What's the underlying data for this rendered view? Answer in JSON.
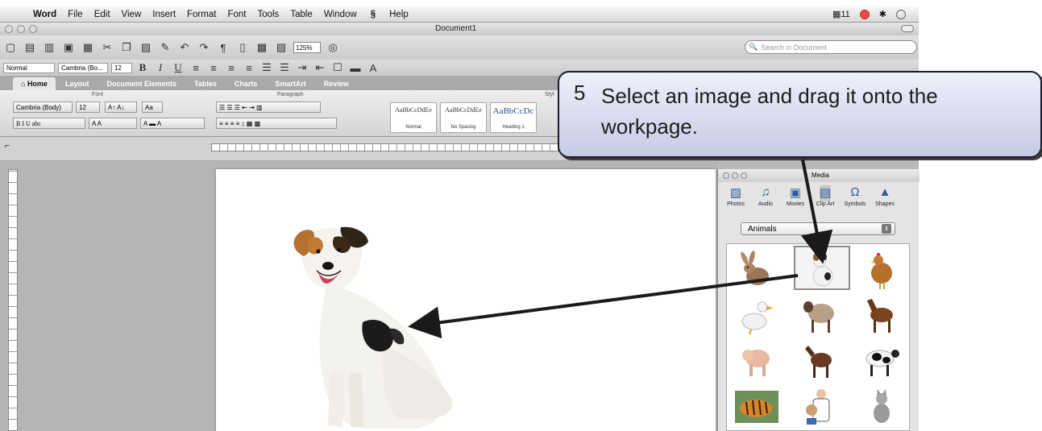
{
  "menubar": {
    "apple": "",
    "items": [
      "Word",
      "File",
      "Edit",
      "View",
      "Insert",
      "Format",
      "Font",
      "Tools",
      "Table",
      "Window",
      "Help"
    ],
    "script_icon": "script-menu-icon",
    "status": "11"
  },
  "window": {
    "title": "Document1",
    "zoom": "125%",
    "search_placeholder": "Search in Document"
  },
  "format_toolbar": {
    "style": "Normal",
    "font": "Cambria (Bo...",
    "size": "12"
  },
  "ribbon_tabs": [
    {
      "label": "Home",
      "active": true
    },
    {
      "label": "Layout"
    },
    {
      "label": "Document Elements"
    },
    {
      "label": "Tables"
    },
    {
      "label": "Charts"
    },
    {
      "label": "SmartArt"
    },
    {
      "label": "Review"
    }
  ],
  "ribbon": {
    "font_group": "Font",
    "paragraph_group": "Paragraph",
    "styles_group": "Styl",
    "font_name": "Cambria (Body)",
    "font_size": "12",
    "styles": [
      {
        "sample": "AaBbCcDdEe",
        "caption": "Normal"
      },
      {
        "sample": "AaBbCcDdEe",
        "caption": "No Spacing"
      },
      {
        "sample": "AaBbCcDc",
        "caption": "Heading 1"
      }
    ]
  },
  "media": {
    "title": "Media",
    "tabs": [
      "Photos",
      "Audio",
      "Movies",
      "Clip Art",
      "Symbols",
      "Shapes"
    ],
    "active_tab": "Clip Art",
    "category": "Animals",
    "clips": [
      "rabbit",
      "dog",
      "hen",
      "duck",
      "sheep",
      "horse",
      "pig",
      "donkey",
      "cow",
      "tiger",
      "vet",
      "cat"
    ],
    "selected_clip": "dog"
  },
  "callout": {
    "step": "5",
    "text": "Select an image and drag it onto the workpage."
  },
  "colors": {
    "callout_fill": "#dfe2f4",
    "callout_border": "#1b1b2e",
    "arrow": "#1a1a1a"
  }
}
